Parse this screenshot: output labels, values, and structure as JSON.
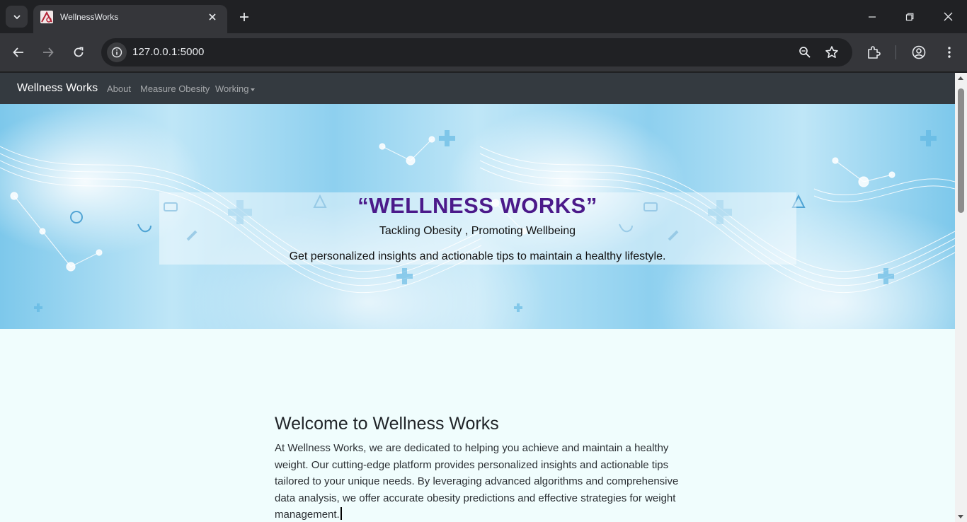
{
  "browser": {
    "tab": {
      "title": "WellnessWorks",
      "favicon": "wellness-favicon"
    },
    "address": {
      "url": "127.0.0.1:5000"
    },
    "icons": [
      "tab-search-icon",
      "close-icon",
      "plus-icon",
      "minimize-icon",
      "restore-icon",
      "window-close-icon",
      "back-icon",
      "forward-icon",
      "reload-icon",
      "site-info-icon",
      "zoom-icon",
      "bookmark-star-icon",
      "extensions-icon",
      "profile-icon",
      "menu-icon"
    ]
  },
  "navbar": {
    "brand": "Wellness Works",
    "links": [
      {
        "label": "About"
      },
      {
        "label": "Measure Obesity"
      },
      {
        "label": "Working"
      }
    ]
  },
  "hero": {
    "title": "“WELLNESS WORKS”",
    "subtitle": "Tackling Obesity , Promoting Wellbeing",
    "description": "Get personalized insights and actionable tips to maintain a healthy lifestyle."
  },
  "welcome": {
    "heading": "Welcome to Wellness Works",
    "body": "At Wellness Works, we are dedicated to helping you achieve and maintain a healthy weight. Our cutting-edge platform provides personalized insights and actionable tips tailored to your unique needs. By leveraging advanced algorithms and comprehensive data analysis, we offer accurate obesity predictions and effective strategies for weight management."
  },
  "colors": {
    "navbar_bg": "#343a40",
    "hero_title": "#4b1a8a",
    "page_bg": "#f0fdfd"
  }
}
